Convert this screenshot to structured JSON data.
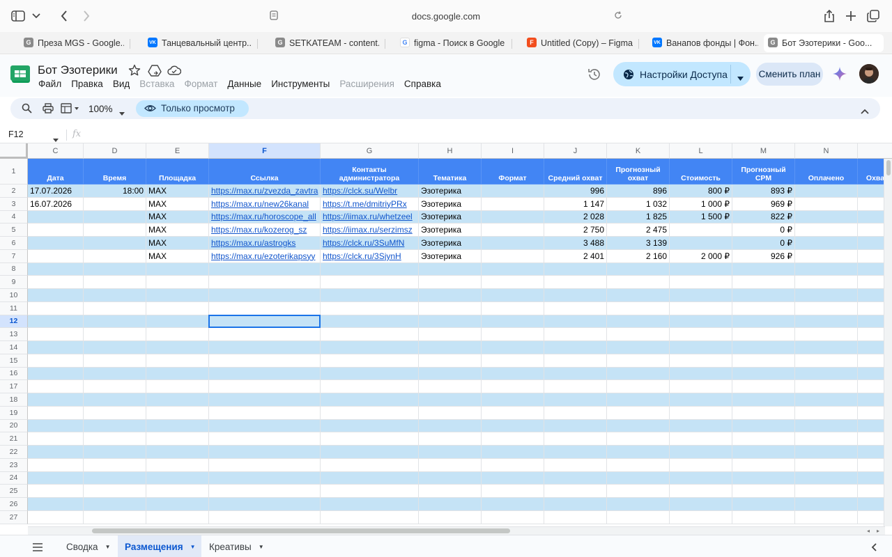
{
  "browser": {
    "url": "docs.google.com",
    "tabs": [
      {
        "label": "Преза MGS - Google...",
        "favicon": "G"
      },
      {
        "label": "Танцевальный центр...",
        "favicon": "VK"
      },
      {
        "label": "SETKATEAM - content...",
        "favicon": "G"
      },
      {
        "label": "figma - Поиск в Google",
        "favicon": "G"
      },
      {
        "label": "Untitled (Copy) – Figma",
        "favicon": "F"
      },
      {
        "label": "Ванапов фонды | Фон...",
        "favicon": "VK"
      },
      {
        "label": "Бот Эзотерики - Goo...",
        "favicon": "G"
      }
    ]
  },
  "doc": {
    "title": "Бот Эзотерики",
    "menu": [
      "Файл",
      "Правка",
      "Вид",
      "Вставка",
      "Формат",
      "Данные",
      "Инструменты",
      "Расширения",
      "Справка"
    ],
    "share_label": "Настройки Доступа",
    "plan_label": "Сменить план",
    "zoom": "100%",
    "view_only_label": "Только просмотр",
    "namebox": "F12",
    "fx": "fx"
  },
  "grid": {
    "columns": [
      "C",
      "D",
      "E",
      "F",
      "G",
      "H",
      "I",
      "J",
      "K",
      "L",
      "M",
      "N",
      ""
    ],
    "selected_column": "F",
    "selected_row": "12",
    "header_row": [
      "Дата",
      "Время",
      "Площадка",
      "Ссылка",
      "Контакты администратора",
      "Тематика",
      "Формат",
      "Средний охват",
      "Прогнозный охват",
      "Стоимость",
      "Прогнозный CPM",
      "Оплачено",
      "Охва"
    ],
    "rows": [
      [
        "17.07.2026",
        "18:00",
        "MAX",
        "https://max.ru/zvezda_zavtra",
        "https://clck.su/Welbr",
        "Эзотерика",
        "",
        "996",
        "896",
        "800 ₽",
        "893 ₽",
        "",
        ""
      ],
      [
        "16.07.2026",
        "",
        "MAX",
        "https://max.ru/new26kanal",
        "https://t.me/dmitriyPRx",
        "Эзотерика",
        "",
        "1 147",
        "1 032",
        "1 000 ₽",
        "969 ₽",
        "",
        ""
      ],
      [
        "",
        "",
        "MAX",
        "https://max.ru/horoscope_all",
        "https://iimax.ru/whetzeel",
        "Эзотерика",
        "",
        "2 028",
        "1 825",
        "1 500 ₽",
        "822 ₽",
        "",
        ""
      ],
      [
        "",
        "",
        "MAX",
        "https://max.ru/kozerog_sz",
        "https://iimax.ru/serzimsz",
        "Эзотерика",
        "",
        "2 750",
        "2 475",
        "",
        "0 ₽",
        "",
        ""
      ],
      [
        "",
        "",
        "MAX",
        "https://max.ru/astrogks",
        "https://clck.ru/3SuMfN",
        "Эзотерика",
        "",
        "3 488",
        "3 139",
        "",
        "0 ₽",
        "",
        ""
      ],
      [
        "",
        "",
        "MAX",
        "https://max.ru/ezoterikapsyy",
        "https://clck.ru/3SjynH",
        "Эзотерика",
        "",
        "2 401",
        "2 160",
        "2 000 ₽",
        "926 ₽",
        "",
        ""
      ]
    ],
    "row_numbers": [
      "1",
      "2",
      "3",
      "4",
      "5",
      "6",
      "7",
      "8",
      "9",
      "10",
      "11",
      "12",
      "13",
      "14",
      "15",
      "16",
      "17",
      "18",
      "19",
      "20",
      "21",
      "22",
      "23",
      "24",
      "25",
      "26",
      "27"
    ]
  },
  "sheets": {
    "items": [
      "Сводка",
      "Размещения",
      "Креативы"
    ],
    "active": "Размещения"
  },
  "colors": {
    "header_blue": "#4285f4",
    "band_blue": "#c5e3f6",
    "link": "#1155cc",
    "accent": "#0b57d0"
  }
}
